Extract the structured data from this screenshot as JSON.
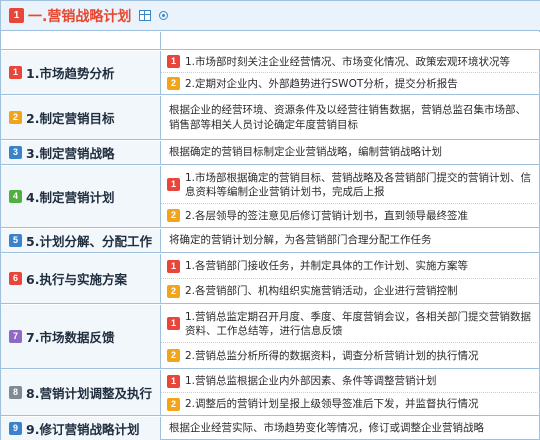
{
  "title": {
    "badge": "1",
    "text": "一.营销战略计划"
  },
  "colors": {
    "red": "#e8463a",
    "orange": "#f2a51a",
    "blue": "#3c82c8",
    "green": "#4fb040",
    "purple": "#8e6ac4",
    "gray": "#7f8a95",
    "title_text": "#e8462f",
    "border": "#9fc1de"
  },
  "icons": {
    "title_icon_1": "table-icon",
    "title_icon_2": "target-icon"
  },
  "rows": [
    {
      "badge": "1",
      "label": "1.市场趋势分析",
      "items": [
        {
          "badge": "1",
          "text": "1.市场部时刻关注企业经营情况、市场变化情况、政策宏观环境状况等"
        },
        {
          "badge": "2",
          "text": "2.定期对企业内、外部趋势进行SWOT分析，提交分析报告"
        }
      ]
    },
    {
      "badge": "2",
      "label": "2.制定营销目标",
      "text": "根据企业的经营环境、资源条件及以经营往销售数据，营销总监召集市场部、销售部等相关人员讨论确定年度营销目标"
    },
    {
      "badge": "3",
      "label": "3.制定营销战略",
      "text": "根据确定的营销目标制定企业营销战略，编制营销战略计划"
    },
    {
      "badge": "4",
      "label": "4.制定营销计划",
      "items": [
        {
          "badge": "1",
          "text": "1.市场部根据确定的营销目标、营销战略及各营销部门提交的营销计划、信息资料等编制企业营销计划书，完成后上报"
        },
        {
          "badge": "2",
          "text": "2.各层领导的签注意见后修订营销计划书，直到领导最终签准"
        }
      ]
    },
    {
      "badge": "5",
      "label": "5.计划分解、分配工作",
      "text": "将确定的营销计划分解，为各营销部门合理分配工作任务"
    },
    {
      "badge": "6",
      "label": "6.执行与实施方案",
      "items": [
        {
          "badge": "1",
          "text": "1.各营销部门接收任务，并制定具体的工作计划、实施方案等"
        },
        {
          "badge": "2",
          "text": "2.各营销部门、机构组织实施营销活动，企业进行营销控制"
        }
      ]
    },
    {
      "badge": "7",
      "label": "7.市场数据反馈",
      "items": [
        {
          "badge": "1",
          "text": "1.营销总监定期召开月度、季度、年度营销会议，各相关部门提交营销数据资料、工作总结等，进行信息反馈"
        },
        {
          "badge": "2",
          "text": "2.营销总监分析所得的数据资料，调查分析营销计划的执行情况"
        }
      ]
    },
    {
      "badge": "8",
      "label": "8.营销计划调整及执行",
      "items": [
        {
          "badge": "1",
          "text": "1.营销总监根据企业内外部因素、条件等调整营销计划"
        },
        {
          "badge": "2",
          "text": "2.调整后的营销计划呈报上级领导签准后下发，并监督执行情况"
        }
      ]
    },
    {
      "badge": "9",
      "label": "9.修订营销战略计划",
      "text": "根据企业经营实际、市场趋势变化等情况，修订或调整企业营销战略"
    }
  ]
}
